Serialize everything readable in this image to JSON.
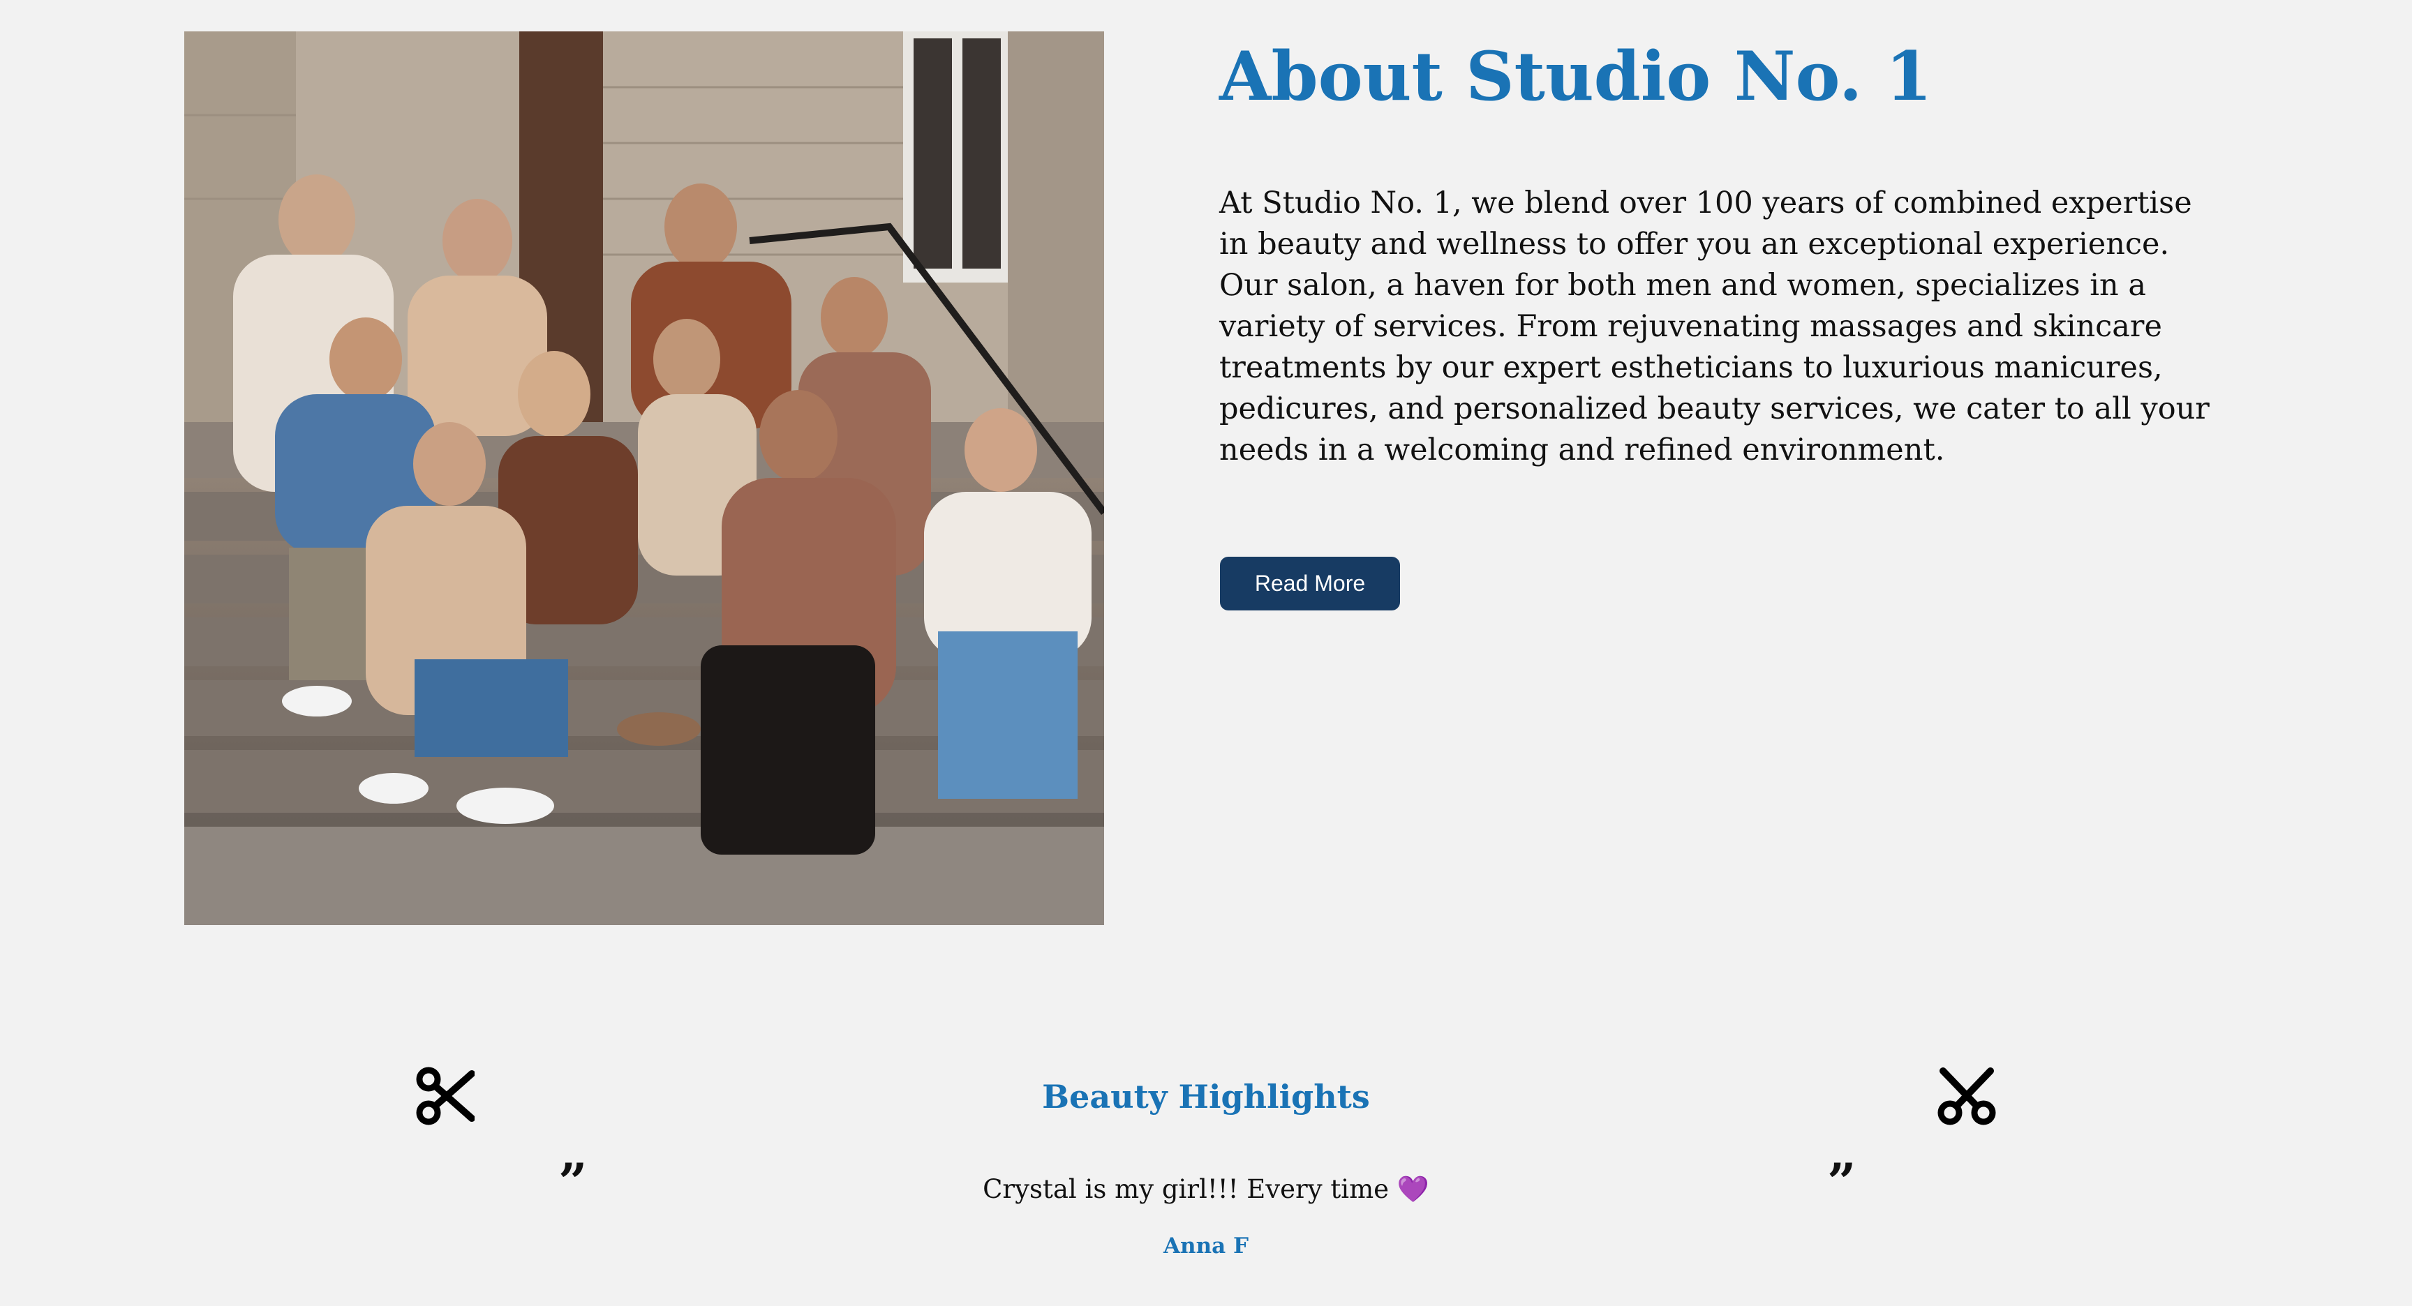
{
  "about": {
    "title": "About Studio No. 1",
    "body": "At Studio No. 1, we blend over 100 years of combined expertise in beauty and wellness to offer you an exceptional experience. Our salon, a haven for both men and women, specializes in a variety of services. From rejuvenating massages and skincare treatments by our expert estheticians to luxurious manicures, pedicures, and personalized beauty services, we cater to all your needs in a welcoming and refined environment.",
    "button_label": "Read More"
  },
  "highlights": {
    "title": "Beauty Highlights",
    "quote_left": "”",
    "quote_right": "”",
    "testimonial": "Crystal is my girl!!! Every time 💜",
    "author": "Anna F"
  },
  "icons": {
    "left": "scissors-icon",
    "right": "scissors-icon"
  },
  "colors": {
    "background": "#f2f2f2",
    "accent": "#1a73b5",
    "button": "#173b63"
  }
}
